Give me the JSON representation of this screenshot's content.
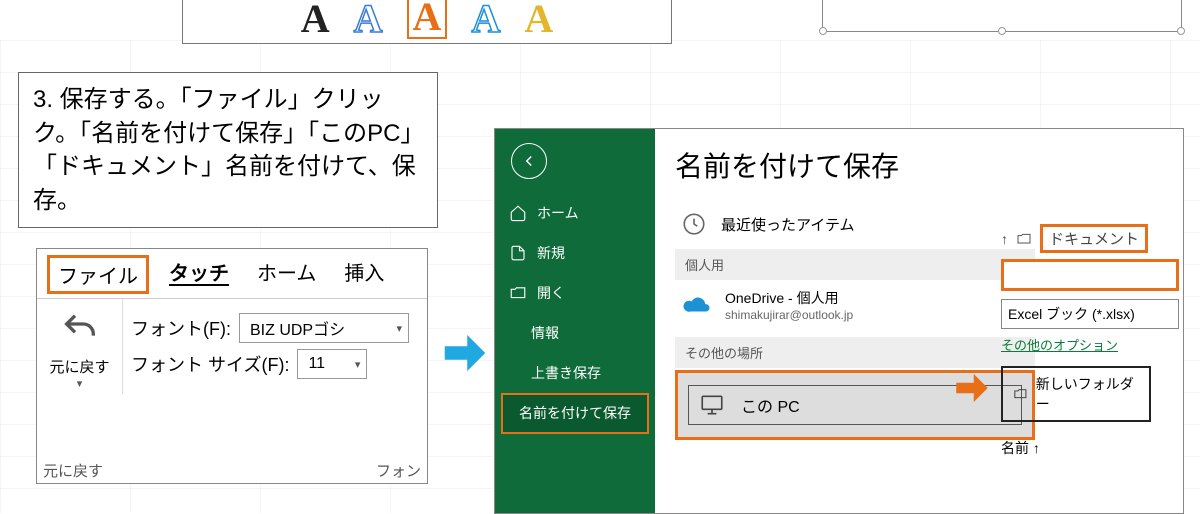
{
  "instruction": "3. 保存する。「ファイル」クリック。「名前を付けて保存」「このPC」「ドキュメント」名前を付けて、保存。",
  "ribbon": {
    "tabs": {
      "file": "ファイル",
      "touch": "タッチ",
      "home": "ホーム",
      "insert": "挿入"
    },
    "undo_label": "元に戻す",
    "font_label": "フォント(F):",
    "font_value": "BIZ UDPゴシ",
    "fontsize_label": "フォント サイズ(F):",
    "fontsize_value": "11",
    "footer_left": "元に戻す",
    "footer_right": "フォン"
  },
  "backstage": {
    "title": "名前を付けて保存",
    "nav": {
      "home": "ホーム",
      "new": "新規",
      "open": "開く",
      "info": "情報",
      "save": "上書き保存",
      "saveas": "名前を付けて保存"
    },
    "locations": {
      "recent": "最近使ったアイテム",
      "personal_section": "個人用",
      "onedrive_title": "OneDrive - 個人用",
      "onedrive_sub": "shimakujirar@outlook.jp",
      "other_section": "その他の場所",
      "this_pc": "この PC"
    },
    "save_panel": {
      "up_icon": "↑",
      "docs": "ドキュメント",
      "filetype": "Excel ブック (*.xlsx)",
      "other_options": "その他のオプション",
      "new_folder": "新しいフォルダー",
      "name_col": "名前 ↑"
    }
  }
}
